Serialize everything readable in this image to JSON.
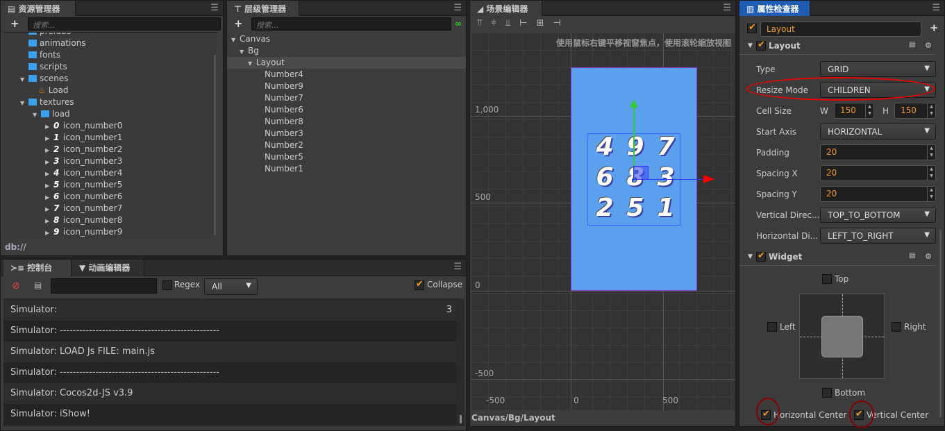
{
  "assets": {
    "tab": "资源管理器",
    "search_placeholder": "搜索...",
    "footer": "db://",
    "items": [
      {
        "label": "prefabs",
        "type": "folder"
      },
      {
        "label": "animations",
        "type": "folder"
      },
      {
        "label": "fonts",
        "type": "folder"
      },
      {
        "label": "scripts",
        "type": "folder"
      },
      {
        "label": "scenes",
        "type": "folder",
        "open": true
      },
      {
        "label": "Load",
        "type": "scene"
      },
      {
        "label": "textures",
        "type": "folder",
        "open": true
      },
      {
        "label": "load",
        "type": "folder",
        "open": true
      }
    ],
    "textures": [
      {
        "glyph": "0",
        "label": "icon_number0"
      },
      {
        "glyph": "1",
        "label": "icon_number1"
      },
      {
        "glyph": "2",
        "label": "icon_number2"
      },
      {
        "glyph": "3",
        "label": "icon_number3"
      },
      {
        "glyph": "4",
        "label": "icon_number4"
      },
      {
        "glyph": "5",
        "label": "icon_number5"
      },
      {
        "glyph": "6",
        "label": "icon_number6"
      },
      {
        "glyph": "7",
        "label": "icon_number7"
      },
      {
        "glyph": "8",
        "label": "icon_number8"
      },
      {
        "glyph": "9",
        "label": "icon_number9"
      }
    ]
  },
  "hierarchy": {
    "tab": "层级管理器",
    "search_placeholder": "搜索...",
    "canvas": "Canvas",
    "bg": "Bg",
    "layout": "Layout",
    "children": [
      "Number4",
      "Number9",
      "Number7",
      "Number6",
      "Number8",
      "Number3",
      "Number2",
      "Number5",
      "Number1"
    ]
  },
  "console": {
    "tabs": [
      "控制台",
      "动画编辑器"
    ],
    "regex_label": "Regex",
    "filter": "All",
    "collapse_label": "Collapse",
    "collapse_checked": true,
    "logs": [
      {
        "text": "Simulator:",
        "count": "3"
      },
      {
        "text": "Simulator: -------------------------------------------------"
      },
      {
        "text": "Simulator: LOAD Js FILE: main.js"
      },
      {
        "text": "Simulator: -------------------------------------------------"
      },
      {
        "text": "Simulator: Cocos2d-JS v3.9"
      },
      {
        "text": "Simulator: iShow!"
      }
    ]
  },
  "scene": {
    "tab": "场景编辑器",
    "hint": "使用鼠标右键平移视窗焦点，使用滚轮缩放视图",
    "breadcrumb": "Canvas/Bg/Layout",
    "y_labels": [
      "1,000",
      "500",
      "0",
      "-500"
    ],
    "x_labels": [
      "-500",
      "0",
      "500"
    ],
    "digits": [
      "4",
      "9",
      "7",
      "6",
      "8",
      "3",
      "2",
      "5",
      "1"
    ],
    "canvas_color": "#5aa0ee"
  },
  "inspector": {
    "tab": "属性检查器",
    "node_name": "Layout",
    "node_active": true,
    "layout": {
      "title": "Layout",
      "type_label": "Type",
      "type": "GRID",
      "resize_label": "Resize Mode",
      "resize": "CHILDREN",
      "cell_label": "Cell Size",
      "w_label": "W",
      "w": "150",
      "h_label": "H",
      "h": "150",
      "axis_label": "Start Axis",
      "axis": "HORIZONTAL",
      "padding_label": "Padding",
      "padding": "20",
      "sx_label": "Spacing X",
      "sx": "20",
      "sy_label": "Spacing Y",
      "sy": "20",
      "vdir_label": "Vertical Direc...",
      "vdir": "TOP_TO_BOTTOM",
      "hdir_label": "Horizontal Di...",
      "hdir": "LEFT_TO_RIGHT"
    },
    "widget": {
      "title": "Widget",
      "top": "Top",
      "left": "Left",
      "right": "Right",
      "bottom": "Bottom",
      "hcenter": "Horizontal Center",
      "vcenter": "Vertical Center"
    }
  }
}
